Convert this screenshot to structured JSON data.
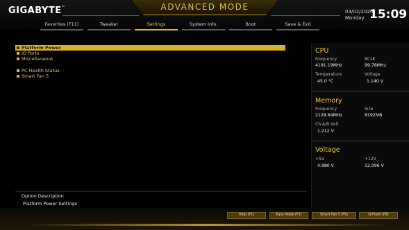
{
  "header": {
    "brand": "GIGABYTE",
    "brand_mark": "™",
    "title": "ADVANCED MODE",
    "date": "03/02/2020",
    "weekday": "Monday",
    "time": "15:09"
  },
  "tabs": [
    {
      "label": "Favorites (F11)",
      "active": false
    },
    {
      "label": "Tweaker",
      "active": false
    },
    {
      "label": "Settings",
      "active": true
    },
    {
      "label": "System Info.",
      "active": false
    },
    {
      "label": "Boot",
      "active": false
    },
    {
      "label": "Save & Exit",
      "active": false
    }
  ],
  "menu": {
    "items": [
      {
        "label": "Platform Power"
      },
      {
        "label": "IO Ports"
      },
      {
        "label": "Miscellaneous"
      },
      {
        "label": "PC Health Status"
      },
      {
        "label": "Smart Fan 5"
      }
    ]
  },
  "panel": {
    "cpu": {
      "title": "CPU",
      "frequency_label": "Frequency",
      "frequency": "4191.19MHz",
      "bclk_label": "BCLK",
      "bclk": "99.78MHz",
      "temperature_label": "Temperature",
      "temperature": "45.0 °C",
      "voltage_label": "Voltage",
      "voltage": "1.140 V"
    },
    "memory": {
      "title": "Memory",
      "frequency_label": "Frequency",
      "frequency": "2128.64MHz",
      "size_label": "Size",
      "size": "8192MB",
      "volt_label": "Ch A/B Volt",
      "volt": "1.212 V"
    },
    "voltage": {
      "title": "Voltage",
      "p5v_label": "+5V",
      "p5v": "4.980 V",
      "p12v_label": "+12V",
      "p12v": "12.096 V"
    }
  },
  "description": {
    "title": "Option Description",
    "text": "Platform Power Settings"
  },
  "footer": {
    "help": "Help (F1)",
    "easy": "Easy Mode (F2)",
    "fan": "Smart Fan 5 (F6)",
    "qflash": "Q-Flash (F8)"
  },
  "colors": {
    "accent": "#e6b52b",
    "selected_bg": "#d8b226",
    "background": "#000000"
  }
}
